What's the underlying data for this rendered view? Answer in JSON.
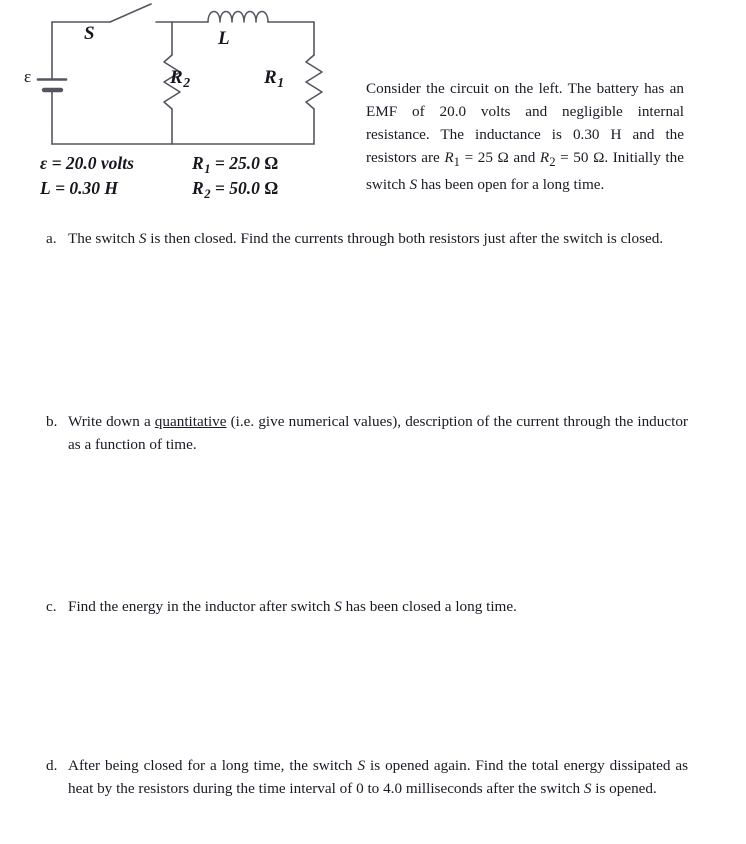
{
  "document": {
    "type": "physics-problem-worksheet",
    "background_color": "#ffffff",
    "text_color": "#1a1a24"
  },
  "figure": {
    "name": "rl-circuit-schematic",
    "stroke_color": "#555560",
    "labels": {
      "switch": "S",
      "inductor": "L",
      "resistor_2": "R",
      "resistor_2_sub": "2",
      "resistor_1": "R",
      "resistor_1_sub": "1",
      "emf_source": "ε"
    },
    "components": [
      "battery",
      "switch",
      "inductor",
      "resistor-R1",
      "resistor-R2",
      "wires"
    ],
    "values": {
      "row1_left_label": "ε = 20.0 volts",
      "row1_left_symbol": "ε",
      "row1_left_value": "= 20.0 volts",
      "row1_right_symbol": "R",
      "row1_right_sub": "1",
      "row1_right_value": "= 25.0 ",
      "row1_right_unit": "Ω",
      "row2_left_symbol": "L",
      "row2_left_value": "= 0.30 H",
      "row2_right_symbol": "R",
      "row2_right_sub": "2",
      "row2_right_value": "= 50.0 ",
      "row2_right_unit": "Ω"
    }
  },
  "intro": {
    "segments": {
      "s1": "Consider the circuit on the left. The battery has an EMF of 20.0 volts and negligible internal resistance. The inductance is 0.30 H and the resistors are ",
      "r1": "R",
      "r1_sub": "1",
      "s2": " = 25 Ω and ",
      "r2": "R",
      "r2_sub": "2",
      "s3": " = 50 Ω. Initially the switch ",
      "sw": "S",
      "s4": " has been open for a long time."
    }
  },
  "questions": [
    {
      "id": "a",
      "marker": "a.",
      "segments": {
        "s1": "The switch ",
        "m1": "S",
        "s2": " is then closed. Find the currents through both resistors just after the switch is closed."
      }
    },
    {
      "id": "b",
      "marker": "b.",
      "segments": {
        "s1": "Write down a ",
        "u1": "quantitative",
        "s2": " (i.e. give numerical values), description of the current through the inductor as a function of time."
      }
    },
    {
      "id": "c",
      "marker": "c.",
      "segments": {
        "s1": "Find the energy in the inductor after switch ",
        "m1": "S",
        "s2": " has been closed a long time."
      }
    },
    {
      "id": "d",
      "marker": "d.",
      "segments": {
        "s1": "After being closed for a long time, the switch ",
        "m1": "S",
        "s2": " is opened again. Find the total energy dissipated as heat by the resistors during the time interval of 0 to 4.0 milliseconds after the switch ",
        "m2": "S",
        "s3": " is opened."
      }
    }
  ]
}
